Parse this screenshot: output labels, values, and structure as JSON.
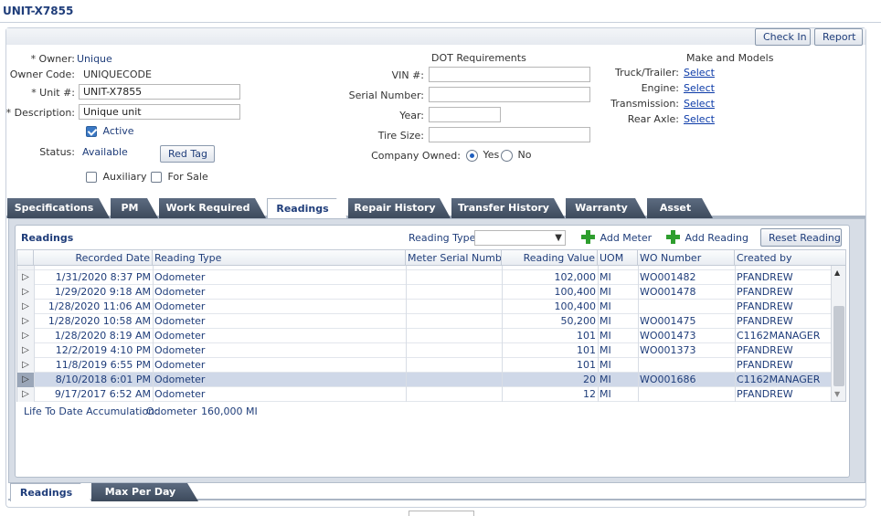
{
  "page": {
    "title": "UNIT-X7855"
  },
  "toolbar": {
    "check_in": "Check In",
    "report": "Report"
  },
  "form": {
    "owner_label": "* Owner:",
    "owner_value": "Unique",
    "owner_code_label": "Owner Code:",
    "owner_code_value": "UNIQUECODE",
    "unit_label": "* Unit #:",
    "unit_value": "UNIT-X7855",
    "description_label": "* Description:",
    "description_value": "Unique unit",
    "active_label": "Active",
    "status_label": "Status:",
    "status_value": "Available",
    "red_tag": "Red Tag",
    "auxiliary_label": "Auxiliary",
    "for_sale_label": "For Sale"
  },
  "dot": {
    "header": "DOT Requirements",
    "vin_label": "VIN #:",
    "serial_label": "Serial Number:",
    "year_label": "Year:",
    "tire_label": "Tire Size:",
    "company_owned_label": "Company Owned:",
    "yes": "Yes",
    "no": "No"
  },
  "make": {
    "header": "Make and Models",
    "truck_label": "Truck/Trailer:",
    "engine_label": "Engine:",
    "transmission_label": "Transmission:",
    "rear_axle_label": "Rear Axle:",
    "select": "Select"
  },
  "tabs": [
    "Specifications",
    "PM",
    "Work Required",
    "Readings",
    "Repair History",
    "Transfer History",
    "Warranty",
    "Asset"
  ],
  "readings": {
    "title": "Readings",
    "reading_type_label": "Reading Type",
    "add_meter": "Add Meter",
    "add_reading": "Add Reading",
    "reset_reading": "Reset Reading",
    "columns": [
      "Recorded Date",
      "Reading Type",
      "Meter Serial Number",
      "Reading Value",
      "UOM",
      "WO Number",
      "Created by"
    ],
    "rows": [
      {
        "date": "1/31/2020 8:37 PM",
        "type": "Odometer",
        "serial": "",
        "value": "102,000",
        "uom": "MI",
        "wo": "WO001482",
        "by": "PFANDREW"
      },
      {
        "date": "1/29/2020 9:18 AM",
        "type": "Odometer",
        "serial": "",
        "value": "100,400",
        "uom": "MI",
        "wo": "WO001478",
        "by": "PFANDREW"
      },
      {
        "date": "1/28/2020 11:06 AM",
        "type": "Odometer",
        "serial": "",
        "value": "100,400",
        "uom": "MI",
        "wo": "",
        "by": "PFANDREW"
      },
      {
        "date": "1/28/2020 10:58 AM",
        "type": "Odometer",
        "serial": "",
        "value": "50,200",
        "uom": "MI",
        "wo": "WO001475",
        "by": "PFANDREW"
      },
      {
        "date": "1/28/2020 8:19 AM",
        "type": "Odometer",
        "serial": "",
        "value": "101",
        "uom": "MI",
        "wo": "WO001473",
        "by": "C1162MANAGER"
      },
      {
        "date": "12/2/2019 4:10 PM",
        "type": "Odometer",
        "serial": "",
        "value": "101",
        "uom": "MI",
        "wo": "WO001373",
        "by": "PFANDREW"
      },
      {
        "date": "11/8/2019 6:55 PM",
        "type": "Odometer",
        "serial": "",
        "value": "101",
        "uom": "MI",
        "wo": "",
        "by": "PFANDREW"
      },
      {
        "date": "8/10/2018 6:01 PM",
        "type": "Odometer",
        "serial": "",
        "value": "20",
        "uom": "MI",
        "wo": "WO001686",
        "by": "C1162MANAGER"
      },
      {
        "date": "9/17/2017 6:52 AM",
        "type": "Odometer",
        "serial": "",
        "value": "12",
        "uom": "MI",
        "wo": "",
        "by": "PFANDREW"
      }
    ],
    "ltd_label": "Life To Date Accumulation:",
    "ltd_type": "Odometer",
    "ltd_value": "160,000",
    "ltd_uom": "MI"
  },
  "bottom_tabs": [
    "Readings",
    "Max Per Day"
  ],
  "icons": {
    "row_expand": "triangle-right-icon",
    "add": "green-plus-icon",
    "dropdown": "chevron-down-icon"
  },
  "colors": {
    "accent": "#1f3d7a",
    "tab_dark": "#4a576b",
    "selected_row": "#cfd8e8",
    "plus_green": "#2e9e2e"
  }
}
